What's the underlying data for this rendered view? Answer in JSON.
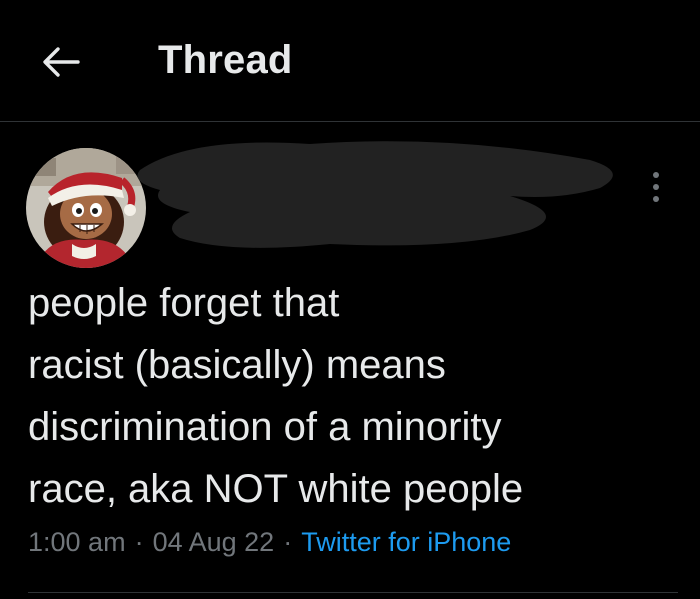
{
  "header": {
    "title": "Thread",
    "back_icon": "arrow-left-icon"
  },
  "tweet": {
    "avatar_icon": "cartoon-avatar-santa-hat",
    "author_redacted": true,
    "more_icon": "more-vertical-icon",
    "text": "people forget that\nracist (basically) means\ndiscrimination of a minority\nrace, aka NOT white people",
    "time": "1:00 am",
    "date": "04 Aug 22",
    "separator": "·",
    "source": "Twitter for iPhone"
  },
  "colors": {
    "background": "#000000",
    "text": "#e7e9ea",
    "muted": "#71767b",
    "link": "#1d9bf0",
    "divider": "#2f3336"
  }
}
